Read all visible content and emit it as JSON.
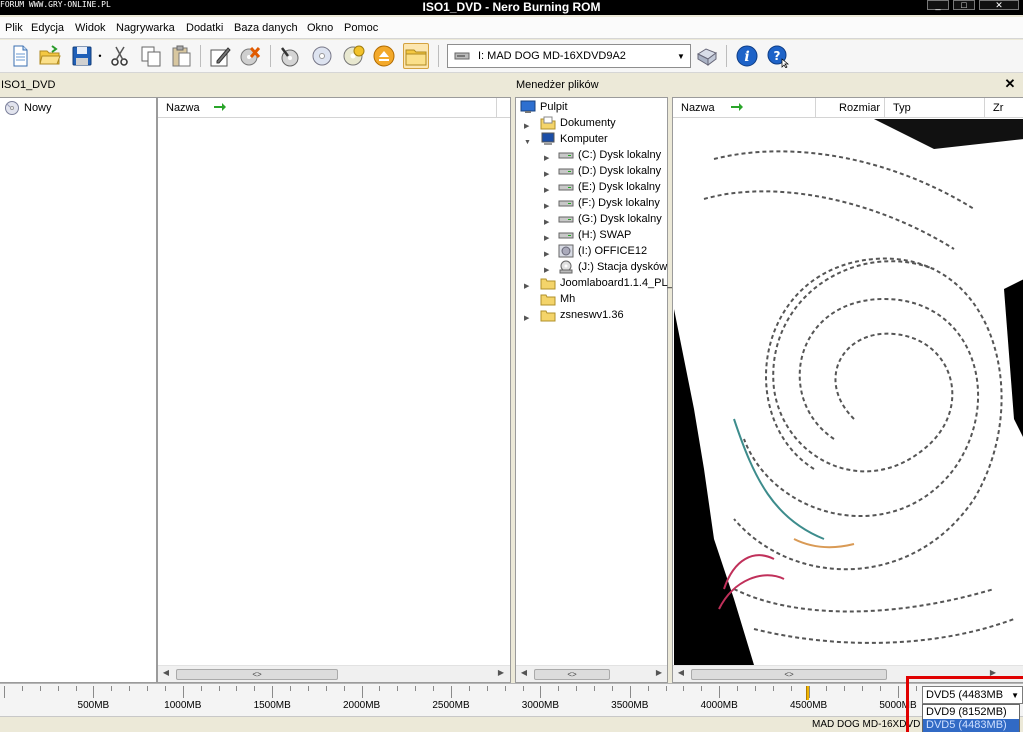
{
  "window": {
    "title": "ISO1_DVD - Nero Burning ROM",
    "watermark": "FORUM WWW.GRY-ONLINE.PL",
    "controls": {
      "minimize": "_",
      "maximize": "□",
      "close": "✕"
    }
  },
  "menu": [
    "Plik",
    "Edycja",
    "Widok",
    "Nagrywarka",
    "Dodatki",
    "Baza danych",
    "Okno",
    "Pomoc"
  ],
  "toolbar": {
    "buttons": [
      "new-icon",
      "open-folder-icon",
      "save-icon",
      "cut-icon",
      "copy-icon",
      "paste-icon",
      "edit-compilation-icon",
      "erase-disc-icon",
      "record-icon",
      "copy-disc-icon",
      "disc-info-icon",
      "eject-icon",
      "browser-folder-icon",
      "recorder-icon",
      "about-icon",
      "help-icon"
    ],
    "drive": "I: MAD DOG  MD-16XDVD9A2"
  },
  "left_panel": {
    "title": "ISO1_DVD",
    "tree": [
      {
        "label": "Nowy"
      }
    ],
    "columns": [
      "Nazwa"
    ]
  },
  "file_manager": {
    "title": "Menedżer plików",
    "tree": [
      {
        "label": "Pulpit"
      },
      {
        "label": "Dokumenty"
      },
      {
        "label": "Komputer"
      },
      {
        "label": "(C:) Dysk lokalny"
      },
      {
        "label": "(D:) Dysk lokalny"
      },
      {
        "label": "(E:) Dysk lokalny"
      },
      {
        "label": "(F:) Dysk lokalny"
      },
      {
        "label": "(G:) Dysk lokalny"
      },
      {
        "label": "(H:) SWAP"
      },
      {
        "label": "(I:) OFFICE12"
      },
      {
        "label": "(J:) Stacja dysków"
      },
      {
        "label": "Joomlaboard1.1.4_PL_"
      },
      {
        "label": "Mh"
      },
      {
        "label": "zsneswv1.36"
      }
    ],
    "columns": [
      "Nazwa",
      "Rozmiar",
      "Typ",
      "Zr"
    ]
  },
  "capacity": {
    "labels": [
      "500MB",
      "1000MB",
      "1500MB",
      "2000MB",
      "2500MB",
      "3000MB",
      "3500MB",
      "4000MB",
      "4500MB",
      "5000MB"
    ],
    "marker_mb": 4483
  },
  "disc_type": {
    "selected": "DVD5 (4483MB",
    "options": [
      "DVD9 (8152MB)",
      "DVD5 (4483MB)"
    ],
    "highlighted": 1
  },
  "status": {
    "drive": "MAD DOG  MD-16XDVD"
  },
  "colors": {
    "accent_red": "#e00000",
    "selection_blue": "#316ac5",
    "folder_yellow": "#f4d46a"
  }
}
